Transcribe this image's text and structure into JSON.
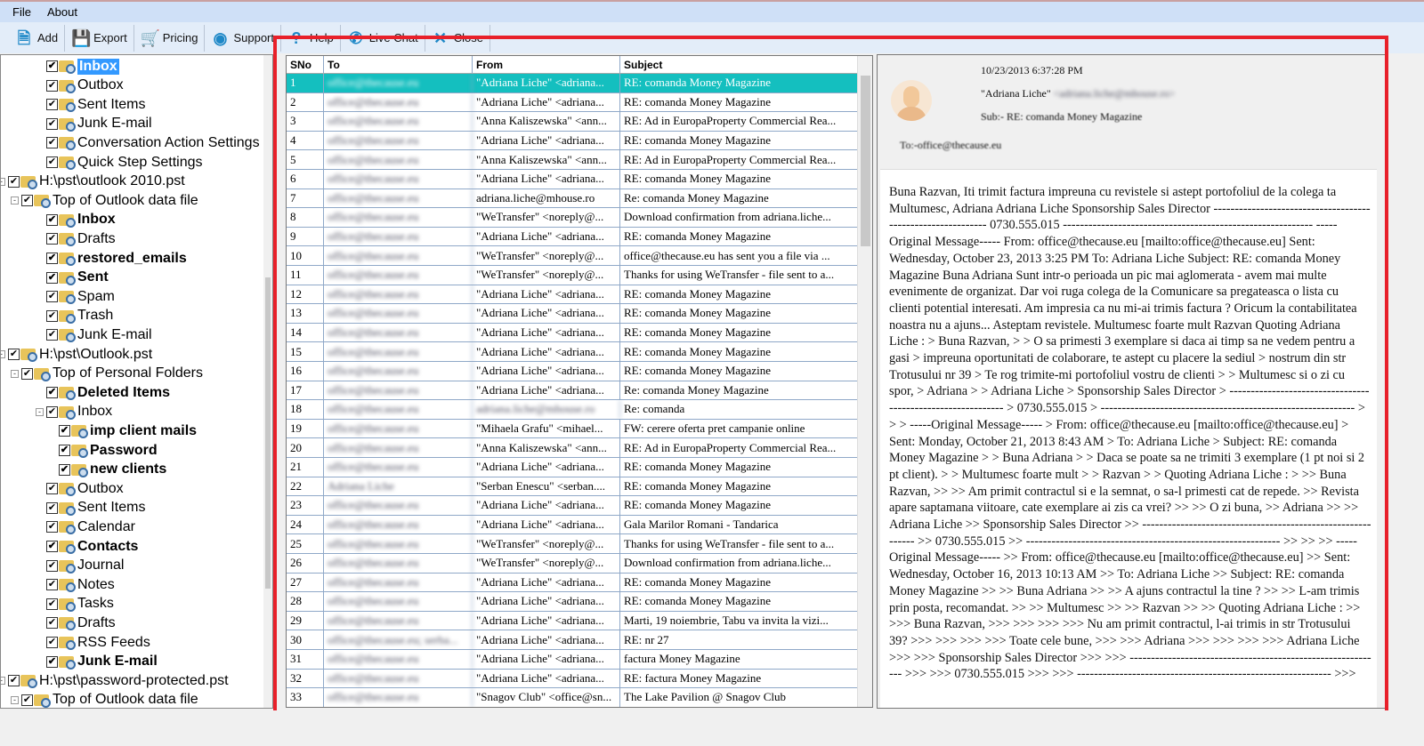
{
  "menu": [
    "File",
    "About"
  ],
  "toolbar": [
    {
      "label": "Add",
      "icon": "add-file-icon"
    },
    {
      "label": "Export",
      "icon": "save-icon"
    },
    {
      "label": "Pricing",
      "icon": "cart-icon"
    },
    {
      "label": "Support",
      "icon": "support-icon"
    },
    {
      "label": "Help",
      "icon": "help-icon"
    },
    {
      "label": "Live Chat",
      "icon": "phone-icon"
    },
    {
      "label": "Close",
      "icon": "close-icon"
    }
  ],
  "tree": [
    {
      "label": "Inbox",
      "level": 3,
      "bold": true,
      "selected": true
    },
    {
      "label": "Outbox",
      "level": 3
    },
    {
      "label": "Sent Items",
      "level": 3
    },
    {
      "label": "Junk E-mail",
      "level": 3
    },
    {
      "label": "Conversation Action Settings",
      "level": 3
    },
    {
      "label": "Quick Step Settings",
      "level": 3
    },
    {
      "label": "H:\\pst\\outlook 2010.pst",
      "level": 1,
      "toggle": "-"
    },
    {
      "label": "Top of Outlook data file",
      "level": 2,
      "toggle": "-"
    },
    {
      "label": "Inbox",
      "level": 3,
      "bold": true
    },
    {
      "label": "Drafts",
      "level": 3
    },
    {
      "label": "restored_emails",
      "level": 3,
      "bold": true
    },
    {
      "label": "Sent",
      "level": 3,
      "bold": true
    },
    {
      "label": "Spam",
      "level": 3
    },
    {
      "label": "Trash",
      "level": 3
    },
    {
      "label": "Junk E-mail",
      "level": 3
    },
    {
      "label": "H:\\pst\\Outlook.pst",
      "level": 1,
      "toggle": "-"
    },
    {
      "label": "Top of Personal Folders",
      "level": 2,
      "toggle": "-"
    },
    {
      "label": "Deleted Items",
      "level": 3,
      "bold": true
    },
    {
      "label": "Inbox",
      "level": 3,
      "toggle": "-"
    },
    {
      "label": "imp client mails",
      "level": 4,
      "bold": true
    },
    {
      "label": "Password",
      "level": 4,
      "bold": true
    },
    {
      "label": "new clients",
      "level": 4,
      "bold": true
    },
    {
      "label": "Outbox",
      "level": 3
    },
    {
      "label": "Sent Items",
      "level": 3
    },
    {
      "label": "Calendar",
      "level": 3
    },
    {
      "label": "Contacts",
      "level": 3,
      "bold": true
    },
    {
      "label": "Journal",
      "level": 3
    },
    {
      "label": "Notes",
      "level": 3
    },
    {
      "label": "Tasks",
      "level": 3
    },
    {
      "label": "Drafts",
      "level": 3
    },
    {
      "label": "RSS Feeds",
      "level": 3
    },
    {
      "label": "Junk E-mail",
      "level": 3,
      "bold": true
    },
    {
      "label": "H:\\pst\\password-protected.pst",
      "level": 1,
      "toggle": "-"
    },
    {
      "label": "Top of Outlook data file",
      "level": 2,
      "toggle": "-"
    }
  ],
  "table": {
    "columns": [
      "SNo",
      "To",
      "From",
      "Subject"
    ],
    "rows": [
      [
        "1",
        "office@thecause.eu",
        "\"Adriana Liche\" <adriana...",
        "RE: comanda Money Magazine"
      ],
      [
        "2",
        "office@thecause.eu",
        "\"Adriana Liche\" <adriana...",
        "RE: comanda Money Magazine"
      ],
      [
        "3",
        "office@thecause.eu",
        "\"Anna Kaliszewska\" <ann...",
        "RE: Ad in EuropaProperty Commercial Rea..."
      ],
      [
        "4",
        "office@thecause.eu",
        "\"Adriana Liche\" <adriana...",
        "RE: comanda Money Magazine"
      ],
      [
        "5",
        "office@thecause.eu",
        "\"Anna Kaliszewska\" <ann...",
        "RE: Ad in EuropaProperty Commercial Rea..."
      ],
      [
        "6",
        "office@thecause.eu",
        "\"Adriana Liche\" <adriana...",
        "RE: comanda Money Magazine"
      ],
      [
        "7",
        "office@thecause.eu",
        "adriana.liche@mhouse.ro",
        "Re: comanda Money Magazine"
      ],
      [
        "8",
        "office@thecause.eu",
        "\"WeTransfer\" <noreply@...",
        "Download confirmation from adriana.liche..."
      ],
      [
        "9",
        "office@thecause.eu",
        "\"Adriana Liche\" <adriana...",
        "RE: comanda Money Magazine"
      ],
      [
        "10",
        "office@thecause.eu",
        "\"WeTransfer\" <noreply@...",
        "office@thecause.eu has sent you a file via ..."
      ],
      [
        "11",
        "office@thecause.eu",
        "\"WeTransfer\" <noreply@...",
        "Thanks for using WeTransfer - file sent to a..."
      ],
      [
        "12",
        "office@thecause.eu",
        "\"Adriana Liche\" <adriana...",
        "RE: comanda Money Magazine"
      ],
      [
        "13",
        "office@thecause.eu",
        "\"Adriana Liche\" <adriana...",
        "RE: comanda Money Magazine"
      ],
      [
        "14",
        "office@thecause.eu",
        "\"Adriana Liche\" <adriana...",
        "RE: comanda Money Magazine"
      ],
      [
        "15",
        "office@thecause.eu",
        "\"Adriana Liche\" <adriana...",
        "RE: comanda Money Magazine"
      ],
      [
        "16",
        "office@thecause.eu",
        "\"Adriana Liche\" <adriana...",
        "RE: comanda Money Magazine"
      ],
      [
        "17",
        "office@thecause.eu",
        "\"Adriana Liche\" <adriana...",
        "Re: comanda Money Magazine"
      ],
      [
        "18",
        "office@thecause.eu",
        "adriana.liche@mhouse.ro",
        "Re: comanda"
      ],
      [
        "19",
        "office@thecause.eu",
        "\"Mihaela Grafu\" <mihael...",
        "FW: cerere oferta pret campanie online"
      ],
      [
        "20",
        "office@thecause.eu",
        "\"Anna Kaliszewska\" <ann...",
        "RE: Ad in EuropaProperty Commercial Rea..."
      ],
      [
        "21",
        "office@thecause.eu",
        "\"Adriana Liche\" <adriana...",
        "RE: comanda Money Magazine"
      ],
      [
        "22",
        "Adriana Liche",
        "\"Serban Enescu\" <serban....",
        "RE: comanda Money Magazine"
      ],
      [
        "23",
        "office@thecause.eu",
        "\"Adriana Liche\" <adriana...",
        "RE: comanda Money Magazine"
      ],
      [
        "24",
        "office@thecause.eu",
        "\"Adriana Liche\" <adriana...",
        "Gala Marilor Romani - Tandarica"
      ],
      [
        "25",
        "office@thecause.eu",
        "\"WeTransfer\" <noreply@...",
        "Thanks for using WeTransfer - file sent to a..."
      ],
      [
        "26",
        "office@thecause.eu",
        "\"WeTransfer\" <noreply@...",
        "Download confirmation from adriana.liche..."
      ],
      [
        "27",
        "office@thecause.eu",
        "\"Adriana Liche\" <adriana...",
        "RE: comanda Money Magazine"
      ],
      [
        "28",
        "office@thecause.eu",
        "\"Adriana Liche\" <adriana...",
        "RE: comanda Money Magazine"
      ],
      [
        "29",
        "office@thecause.eu",
        "\"Adriana Liche\" <adriana...",
        "Marti, 19 noiembrie, Tabu va invita la vizi..."
      ],
      [
        "30",
        "office@thecause.eu; serba...",
        "\"Adriana Liche\" <adriana...",
        "RE: nr 27"
      ],
      [
        "31",
        "office@thecause.eu",
        "\"Adriana Liche\" <adriana...",
        "factura Money Magazine"
      ],
      [
        "32",
        "office@thecause.eu",
        "\"Adriana Liche\" <adriana...",
        "RE: factura Money Magazine"
      ],
      [
        "33",
        "office@thecause.eu",
        "\"Snagov Club\" <office@sn...",
        "The Lake Pavilion @ Snagov Club"
      ]
    ],
    "selected_index": 0
  },
  "preview": {
    "date": "10/23/2013 6:37:28 PM",
    "from_name": "\"Adriana Liche\"",
    "from_email": "<adriana.liche@mhouse.ro>",
    "subject": "Sub:- RE: comanda Money Magazine",
    "to": "To:-office@thecause.eu",
    "body": "Buna Razvan, Iti trimit factura impreuna cu revistele si astept portofoliul de la colega ta Multumesc, Adriana Adriana Liche Sponsorship Sales Director ------------------------------------------------------------ 0730.555.015 ----------------------------------------------------------- -----Original Message----- From: office@thecause.eu [mailto:office@thecause.eu] Sent: Wednesday, October 23, 2013 3:25 PM To: Adriana Liche Subject: RE: comanda Money Magazine Buna Adriana Sunt intr-o perioada un pic mai aglomerata - avem mai multe evenimente de organizat. Dar voi ruga colega de la Comunicare sa pregateasca o lista cu clienti potential interesati. Am impresia ca nu mi-ai trimis factura ? Oricum la contabilitatea noastra nu a ajuns... Asteptam revistele. Multumesc foarte mult Razvan Quoting Adriana Liche : > Buna Razvan, > > O sa primesti 3 exemplare si daca ai timp sa ne vedem pentru a gasi > impreuna oportunitati de colaborare, te astept cu placere la sediul > nostrum din str Trotusului nr 39 > Te rog trimite-mi portofoliul vostru de clienti > > Multumesc si o zi cu spor, > Adriana > > Adriana Liche > Sponsorship Sales Director > ------------------------------------------------------------ > 0730.555.015 > ------------------------------------------------------------ > > > -----Original Message----- > From: office@thecause.eu [mailto:office@thecause.eu] > Sent: Monday, October 21, 2013 8:43 AM > To: Adriana Liche > Subject: RE: comanda Money Magazine > > Buna Adriana > > Daca se poate sa ne trimiti 3 exemplare (1 pt noi si 2 pt client). > > Multumesc foarte mult > > Razvan > > Quoting Adriana Liche : > >> Buna Razvan, >> >> Am primit contractul si e la semnat, o sa-l primesti cat de repede. >> Revista apare saptamana viitoare, cate exemplare ai zis ca vrei? >> >> O zi buna, >> Adriana >> >> Adriana Liche >> Sponsorship Sales Director >> ------------------------------------------------------------ >> 0730.555.015 >> ------------------------------------------------------------ >> >> >> -----Original Message----- >> From: office@thecause.eu [mailto:office@thecause.eu] >> Sent: Wednesday, October 16, 2013 10:13 AM >> To: Adriana Liche >> Subject: RE: comanda Money Magazine >> >> Buna Adriana >> >> A ajuns contractul la tine ? >> >> L-am trimis prin posta, recomandat. >> >> Multumesc >> >> Razvan >> >> Quoting Adriana Liche : >> >>> Buna Razvan, >>> >>> >>> >>> Nu am primit contractul, l-ai trimis in str Trotusului 39? >>> >>> >>> >>> Toate cele bune, >>> >>> Adriana >>> >>> >>> >>> Adriana Liche >>> >>> Sponsorship Sales Director >>> >>> ------------------------------------------------------------ >>> >>> 0730.555.015 >>> >>> ------------------------------------------------------------ >>>"
  },
  "colors": {
    "selected_row": "#14bfbf",
    "highlight_border": "#e8202a",
    "tree_selection": "#3399ff"
  }
}
